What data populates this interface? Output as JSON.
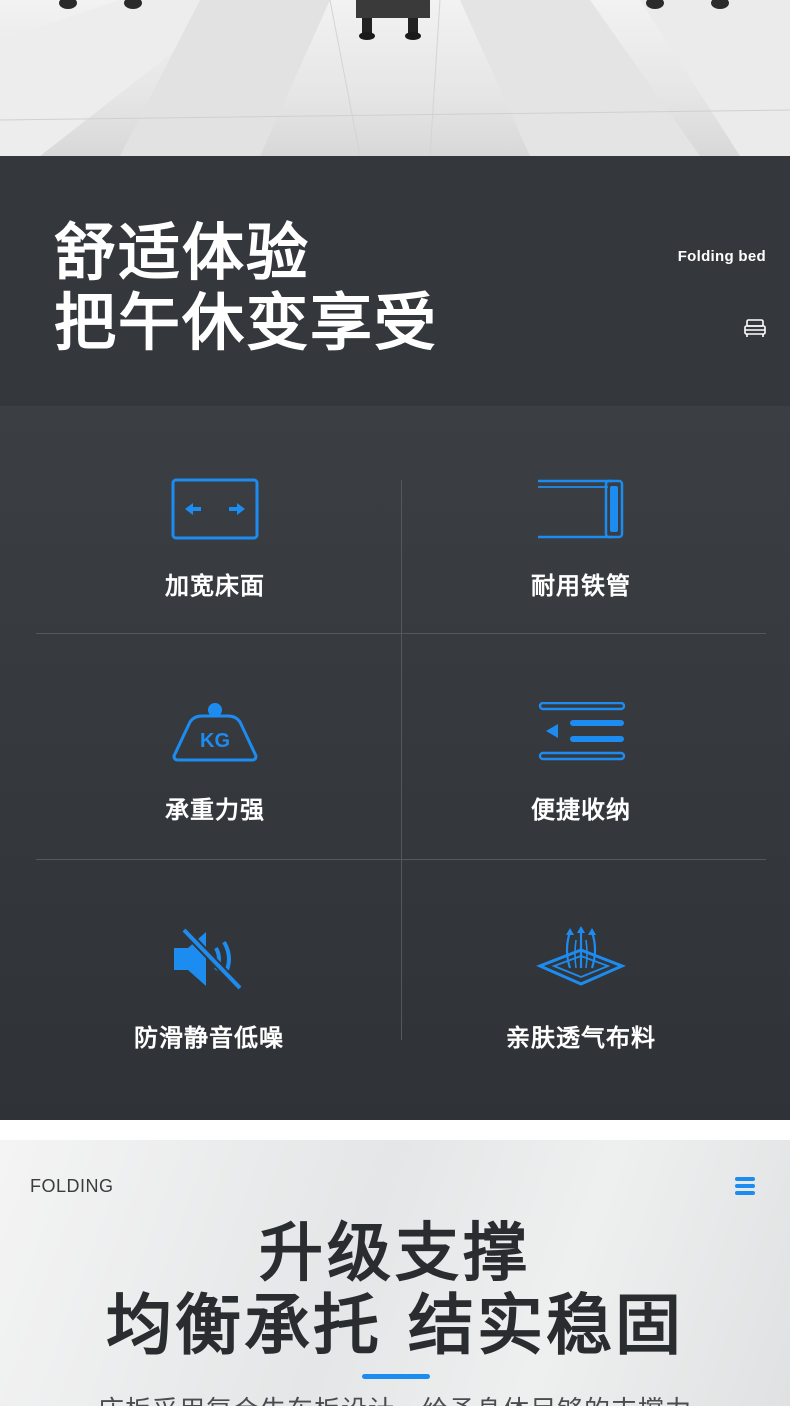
{
  "hero": {
    "title_line1": "舒适体验",
    "title_line2": "把午休变享受",
    "tag": "Folding bed",
    "icon": "bed-icon"
  },
  "features": [
    {
      "label": "加宽床面",
      "icon": "widen-arrows-icon"
    },
    {
      "label": "耐用铁管",
      "icon": "iron-tube-icon"
    },
    {
      "label": "承重力强",
      "icon": "weight-kg-icon",
      "icon_text": "KG"
    },
    {
      "label": "便捷收纳",
      "icon": "storage-menu-icon"
    },
    {
      "label": "防滑静音低噪",
      "icon": "mute-speaker-icon"
    },
    {
      "label": "亲肤透气布料",
      "icon": "breathable-fabric-icon"
    }
  ],
  "lower": {
    "tag": "FOLDING",
    "menu_icon": "menu-icon",
    "title_line1": "升级支撑",
    "title_line2": "均衡承托 结实稳固",
    "description": "床板采用复合牛车板设计，给予身体足够的支撑力"
  },
  "colors": {
    "accent": "#1d8cf0",
    "dark_band": "#34383c",
    "feature_bg": "#3b3f43",
    "text_light": "#ffffff",
    "text_dark": "#2a2d30"
  }
}
